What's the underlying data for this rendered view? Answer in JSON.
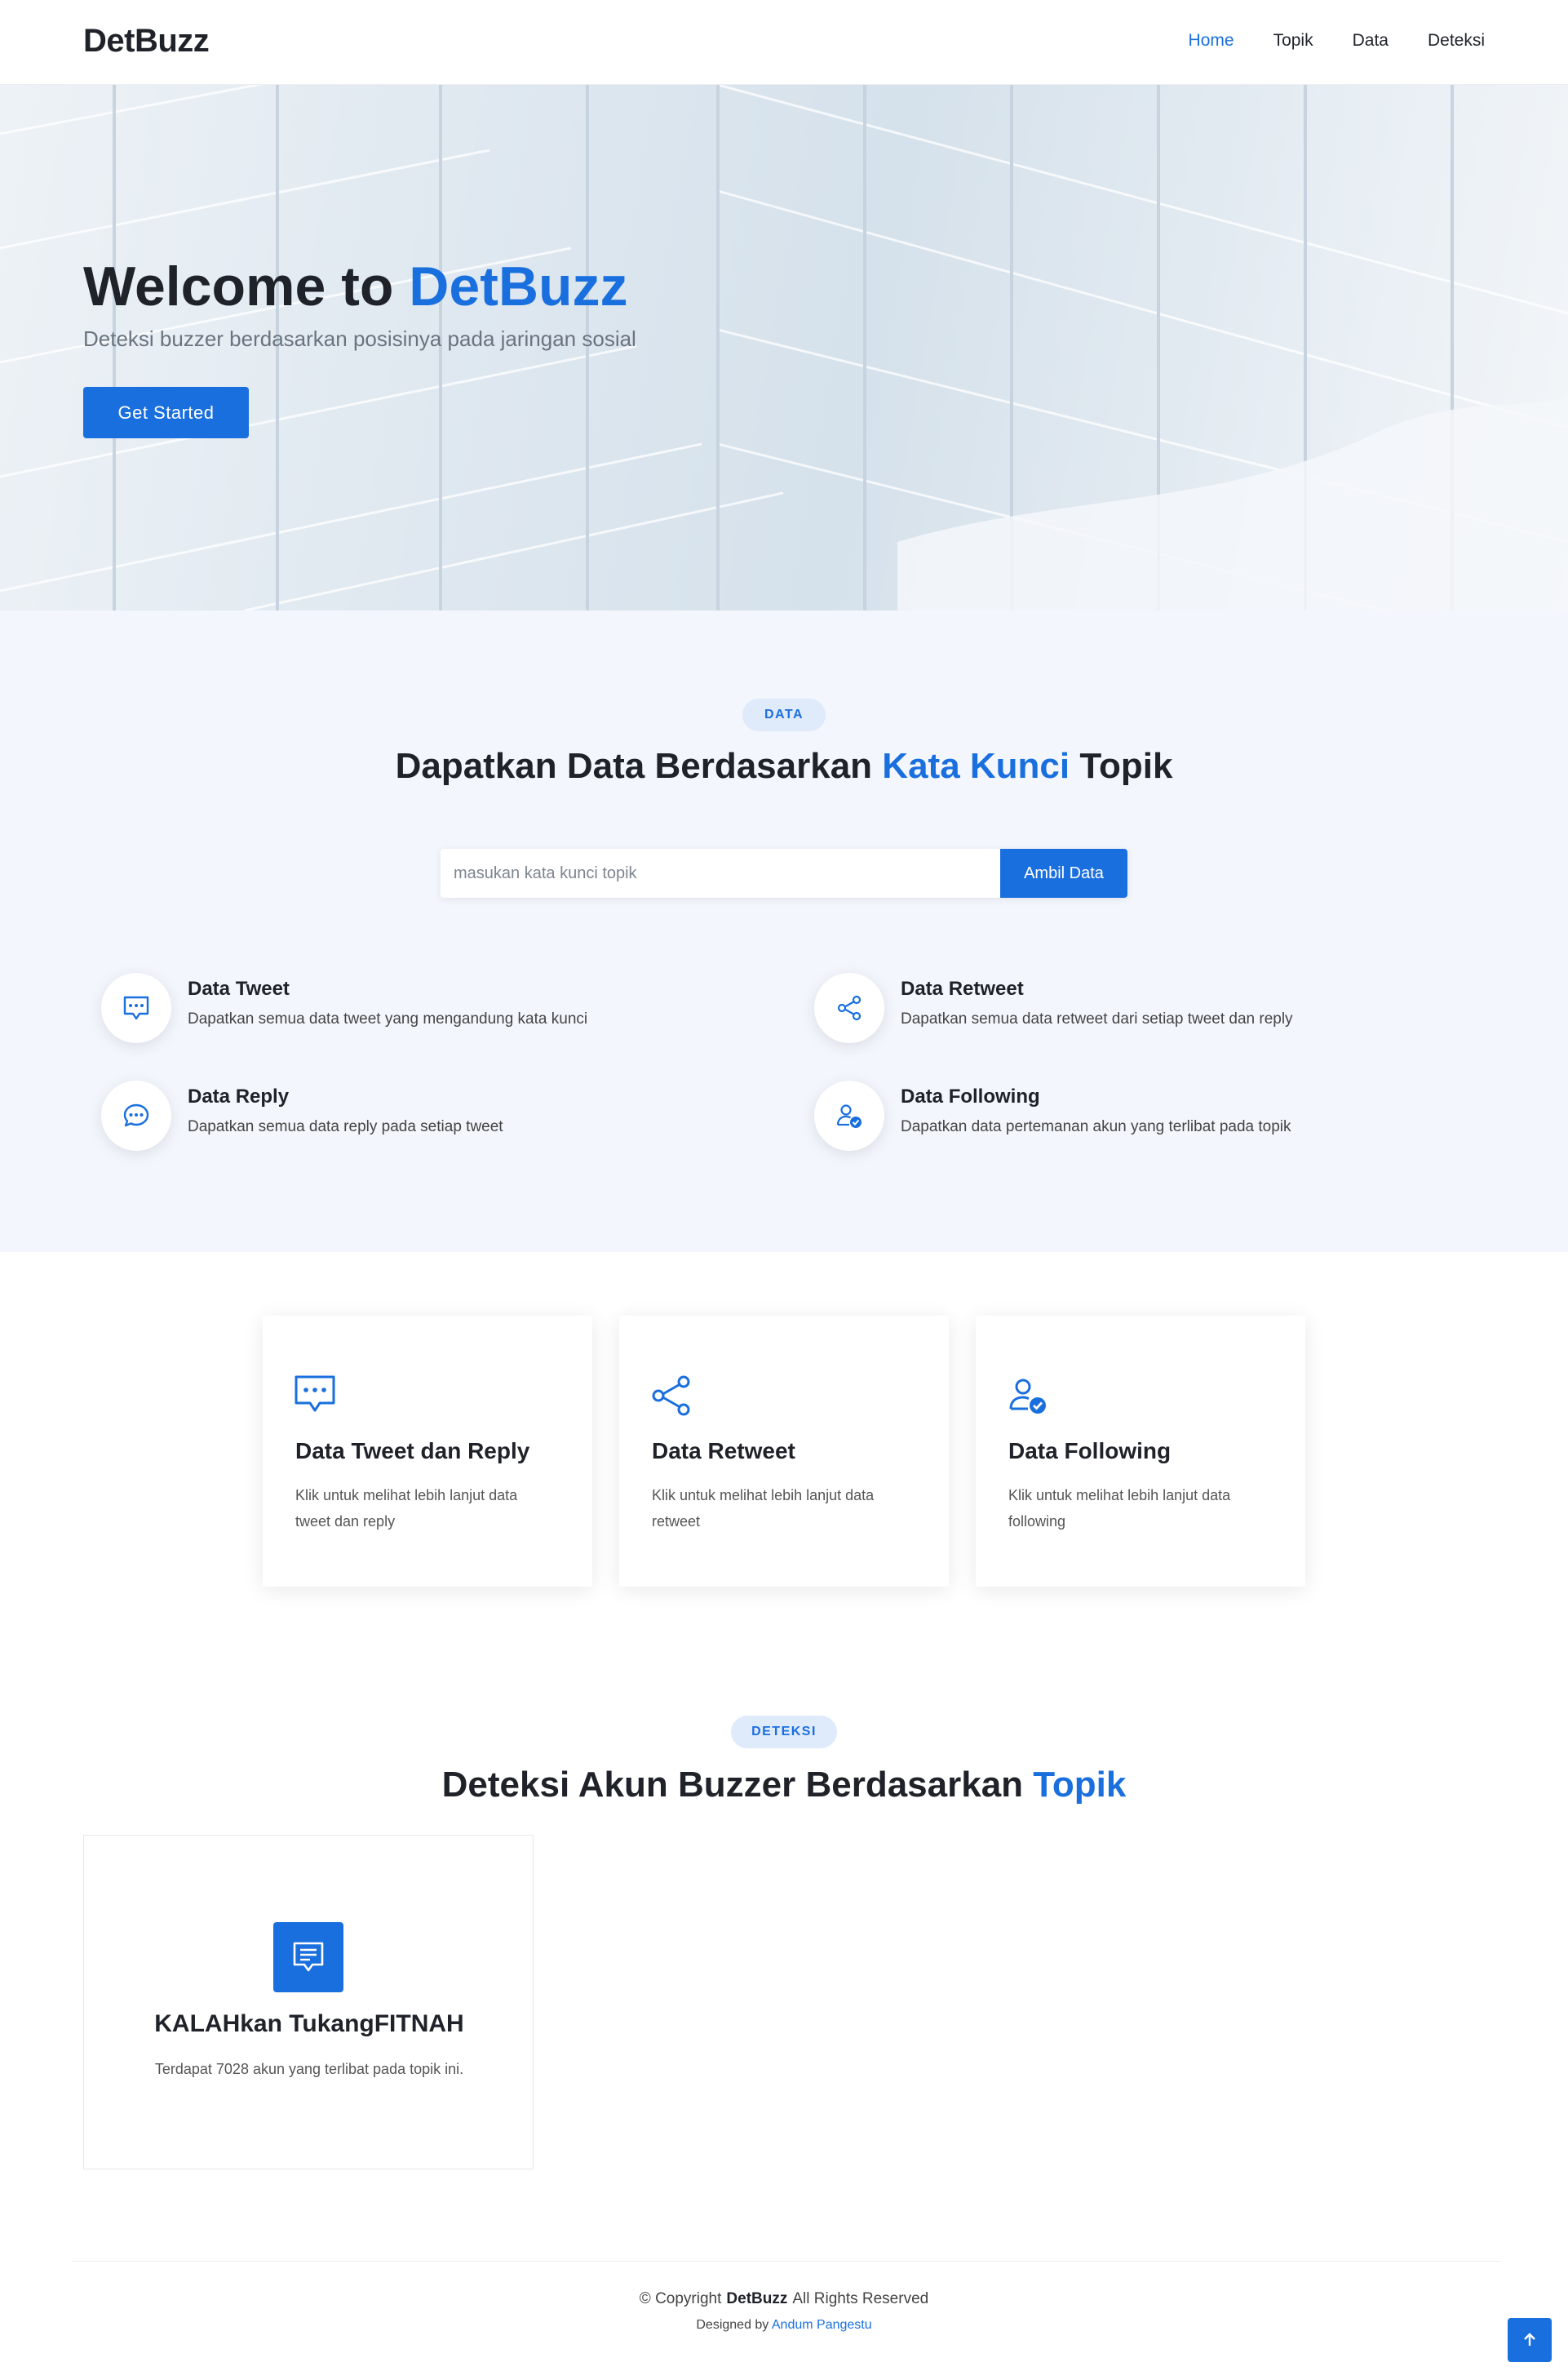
{
  "header": {
    "logo": "DetBuzz",
    "nav": [
      "Home",
      "Topik",
      "Data",
      "Deteksi"
    ],
    "active_nav": "Home"
  },
  "hero": {
    "title_prefix": "Welcome to ",
    "title_accent": "DetBuzz",
    "subtitle": "Deteksi buzzer berdasarkan posisinya pada jaringan sosial",
    "cta": "Get Started"
  },
  "data_section": {
    "badge": "DATA",
    "title_prefix": "Dapatkan Data Berdasarkan ",
    "title_accent": "Kata Kunci",
    "title_suffix": " Topik",
    "search_placeholder": "masukan kata kunci topik",
    "search_button": "Ambil Data",
    "features": [
      {
        "title": "Data Tweet",
        "desc": "Dapatkan semua data tweet yang mengandung kata kunci",
        "icon": "chat-square-dots-icon"
      },
      {
        "title": "Data Retweet",
        "desc": "Dapatkan semua data retweet dari setiap tweet dan reply",
        "icon": "share-icon"
      },
      {
        "title": "Data Reply",
        "desc": "Dapatkan semua data reply pada setiap tweet",
        "icon": "chat-dots-icon"
      },
      {
        "title": "Data Following",
        "desc": "Dapatkan data pertemanan akun yang terlibat pada topik",
        "icon": "person-check-icon"
      }
    ]
  },
  "cards": [
    {
      "title": "Data Tweet dan Reply",
      "desc": "Klik untuk melihat lebih lanjut data tweet dan reply",
      "icon": "chat-square-dots-icon"
    },
    {
      "title": "Data Retweet",
      "desc": "Klik untuk melihat lebih lanjut data retweet",
      "icon": "share-icon"
    },
    {
      "title": "Data Following",
      "desc": "Klik untuk melihat lebih lanjut data following",
      "icon": "person-check-icon"
    }
  ],
  "deteksi_section": {
    "badge": "DETEKSI",
    "title_prefix": "Deteksi Akun Buzzer Berdasarkan ",
    "title_accent": "Topik",
    "topics": [
      {
        "title": "KALAHkan TukangFITNAH",
        "desc": "Terdapat 7028 akun yang terlibat pada topik ini.",
        "icon": "chat-text-icon"
      }
    ]
  },
  "footer": {
    "copyright_prefix": "© Copyright",
    "brand": "DetBuzz",
    "copyright_suffix": "All Rights Reserved",
    "designed_by": "Designed by",
    "author": "Andum Pangestu"
  },
  "colors": {
    "accent": "#1a6fde",
    "section_bg": "#f3f7fd",
    "text": "#1f2229"
  }
}
